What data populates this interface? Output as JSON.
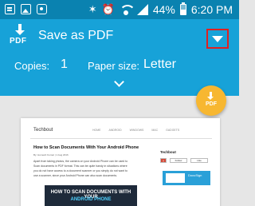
{
  "status_bar": {
    "battery": "44%",
    "time": "6:20 PM",
    "icons": [
      "message-icon",
      "image-icon",
      "outlook-icon",
      "mute-icon",
      "alarm-icon",
      "wifi-icon",
      "signal-icon",
      "battery-icon"
    ]
  },
  "header": {
    "logo_text": "PDF",
    "title": "Save as PDF",
    "copies_label": "Copies:",
    "copies_value": "1",
    "paper_label": "Paper size:",
    "paper_value": "Letter"
  },
  "fab": {
    "label": "PDF"
  },
  "preview": {
    "site_name": "Techbout",
    "nav": [
      "HOME",
      "ANDROID",
      "WINDOWS",
      "MAC",
      "GADGETS"
    ],
    "article_title": "How to Scan Documents With Your Android Phone",
    "byline": "By: Homesh Kumar | 1 Aug 2016",
    "body_lines": [
      "Apart from taking photos, the camera on your Android Phone can be used to",
      "Scan documents in PDF format. This can be quite handy in situations where",
      "you do not have access to a document scanner or you simply do not want to",
      "use a scanner, since your Android Phone can also scan documents."
    ],
    "image_title": "HOW TO SCAN DOCUMENTS WITH YOUR",
    "image_subtitle": "ANDROID PHONE",
    "sidebar_title": "Techbout",
    "social": [
      "Follow",
      "Like"
    ],
    "ad_text": "DocuSign"
  },
  "colors": {
    "status_bar": "#0a82b0",
    "header": "#17a2d8",
    "fab": "#f7b731",
    "highlight": "#e02020"
  }
}
